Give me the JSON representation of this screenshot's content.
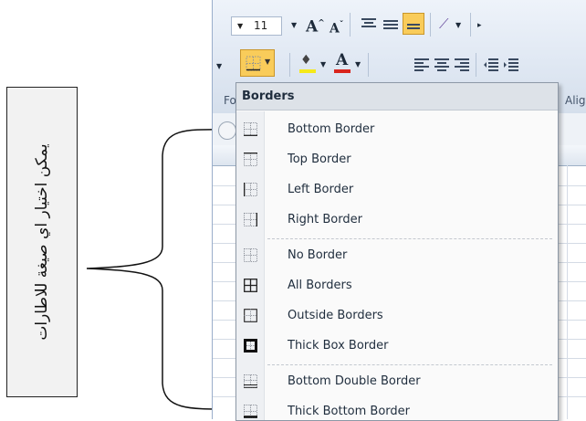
{
  "callout": {
    "text": "يمكن اختيار اي صيغة للاطارات"
  },
  "ribbon": {
    "font_size": "11",
    "grow_font": "A",
    "shrink_font": "A",
    "text_color_letter": "A",
    "font_group_label": "Fo",
    "alignment_group_label": "Align"
  },
  "menu": {
    "title": "Borders",
    "items": [
      {
        "label": "Bottom Border",
        "icon": "bottom-border-icon"
      },
      {
        "label": "Top Border",
        "icon": "top-border-icon"
      },
      {
        "label": "Left Border",
        "icon": "left-border-icon"
      },
      {
        "label": "Right Border",
        "icon": "right-border-icon"
      },
      {
        "label": "No Border",
        "icon": "no-border-icon"
      },
      {
        "label": "All Borders",
        "icon": "all-borders-icon"
      },
      {
        "label": "Outside Borders",
        "icon": "outside-borders-icon"
      },
      {
        "label": "Thick Box Border",
        "icon": "thick-box-border-icon"
      },
      {
        "label": "Bottom Double Border",
        "icon": "bottom-double-border-icon"
      },
      {
        "label": "Thick Bottom Border",
        "icon": "thick-bottom-border-icon"
      }
    ]
  },
  "colors": {
    "highlight": "#f9cc5a",
    "font_color_red": "#d9251d",
    "fill_yellow": "#f5e91a"
  }
}
